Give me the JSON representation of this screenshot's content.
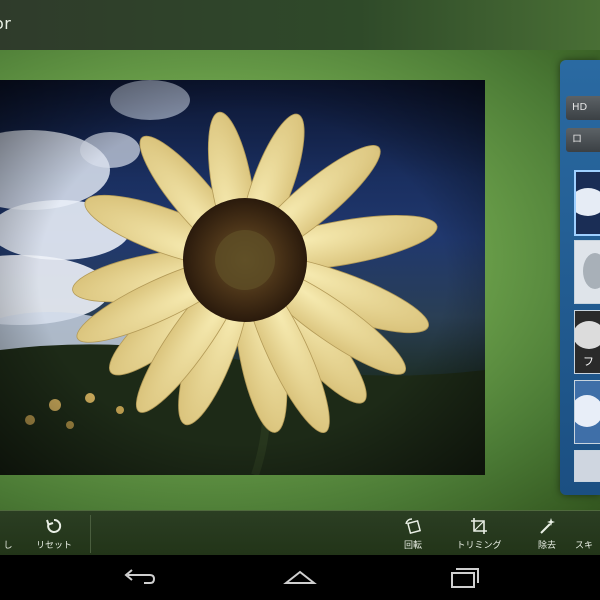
{
  "app": {
    "title": "or"
  },
  "side_panel": {
    "buttons": [
      "HD",
      "ロ"
    ],
    "thumbnail_caption": "フ"
  },
  "toolbar": {
    "left_partial_label": "し",
    "reset_label": "リセット",
    "rotate_label": "回転",
    "trim_label": "トリミング",
    "remove_label": "除去",
    "sketch_label": "スキ"
  },
  "icons": {
    "reset": "rotate-ccw-icon",
    "rotate": "rotate-icon",
    "trim": "crop-icon",
    "remove": "magic-wand-icon",
    "back": "back-icon",
    "home": "home-icon",
    "recents": "recents-icon"
  },
  "colors": {
    "accent_blue": "#1f5f96",
    "panel_green": "#72a84f"
  }
}
